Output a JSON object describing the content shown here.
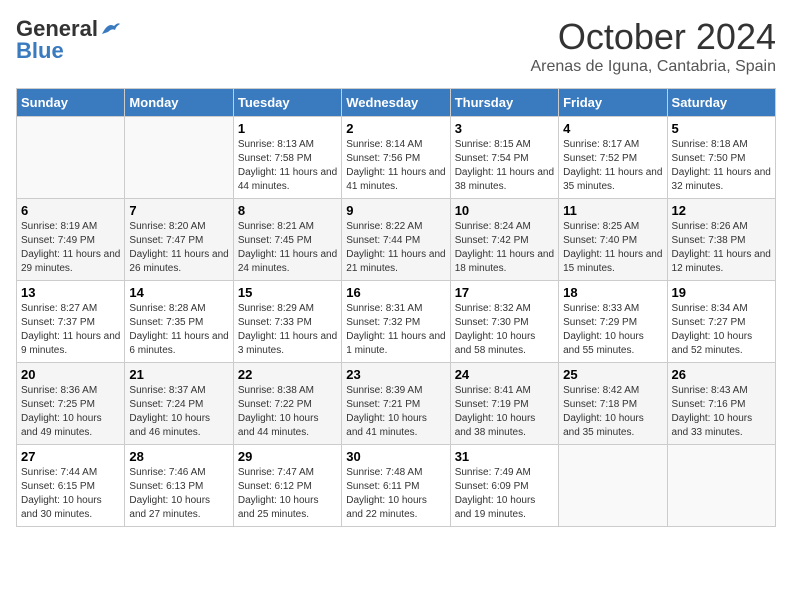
{
  "header": {
    "logo_general": "General",
    "logo_blue": "Blue",
    "month_year": "October 2024",
    "location": "Arenas de Iguna, Cantabria, Spain"
  },
  "weekdays": [
    "Sunday",
    "Monday",
    "Tuesday",
    "Wednesday",
    "Thursday",
    "Friday",
    "Saturday"
  ],
  "weeks": [
    [
      {
        "day": "",
        "info": ""
      },
      {
        "day": "",
        "info": ""
      },
      {
        "day": "1",
        "info": "Sunrise: 8:13 AM\nSunset: 7:58 PM\nDaylight: 11 hours and 44 minutes."
      },
      {
        "day": "2",
        "info": "Sunrise: 8:14 AM\nSunset: 7:56 PM\nDaylight: 11 hours and 41 minutes."
      },
      {
        "day": "3",
        "info": "Sunrise: 8:15 AM\nSunset: 7:54 PM\nDaylight: 11 hours and 38 minutes."
      },
      {
        "day": "4",
        "info": "Sunrise: 8:17 AM\nSunset: 7:52 PM\nDaylight: 11 hours and 35 minutes."
      },
      {
        "day": "5",
        "info": "Sunrise: 8:18 AM\nSunset: 7:50 PM\nDaylight: 11 hours and 32 minutes."
      }
    ],
    [
      {
        "day": "6",
        "info": "Sunrise: 8:19 AM\nSunset: 7:49 PM\nDaylight: 11 hours and 29 minutes."
      },
      {
        "day": "7",
        "info": "Sunrise: 8:20 AM\nSunset: 7:47 PM\nDaylight: 11 hours and 26 minutes."
      },
      {
        "day": "8",
        "info": "Sunrise: 8:21 AM\nSunset: 7:45 PM\nDaylight: 11 hours and 24 minutes."
      },
      {
        "day": "9",
        "info": "Sunrise: 8:22 AM\nSunset: 7:44 PM\nDaylight: 11 hours and 21 minutes."
      },
      {
        "day": "10",
        "info": "Sunrise: 8:24 AM\nSunset: 7:42 PM\nDaylight: 11 hours and 18 minutes."
      },
      {
        "day": "11",
        "info": "Sunrise: 8:25 AM\nSunset: 7:40 PM\nDaylight: 11 hours and 15 minutes."
      },
      {
        "day": "12",
        "info": "Sunrise: 8:26 AM\nSunset: 7:38 PM\nDaylight: 11 hours and 12 minutes."
      }
    ],
    [
      {
        "day": "13",
        "info": "Sunrise: 8:27 AM\nSunset: 7:37 PM\nDaylight: 11 hours and 9 minutes."
      },
      {
        "day": "14",
        "info": "Sunrise: 8:28 AM\nSunset: 7:35 PM\nDaylight: 11 hours and 6 minutes."
      },
      {
        "day": "15",
        "info": "Sunrise: 8:29 AM\nSunset: 7:33 PM\nDaylight: 11 hours and 3 minutes."
      },
      {
        "day": "16",
        "info": "Sunrise: 8:31 AM\nSunset: 7:32 PM\nDaylight: 11 hours and 1 minute."
      },
      {
        "day": "17",
        "info": "Sunrise: 8:32 AM\nSunset: 7:30 PM\nDaylight: 10 hours and 58 minutes."
      },
      {
        "day": "18",
        "info": "Sunrise: 8:33 AM\nSunset: 7:29 PM\nDaylight: 10 hours and 55 minutes."
      },
      {
        "day": "19",
        "info": "Sunrise: 8:34 AM\nSunset: 7:27 PM\nDaylight: 10 hours and 52 minutes."
      }
    ],
    [
      {
        "day": "20",
        "info": "Sunrise: 8:36 AM\nSunset: 7:25 PM\nDaylight: 10 hours and 49 minutes."
      },
      {
        "day": "21",
        "info": "Sunrise: 8:37 AM\nSunset: 7:24 PM\nDaylight: 10 hours and 46 minutes."
      },
      {
        "day": "22",
        "info": "Sunrise: 8:38 AM\nSunset: 7:22 PM\nDaylight: 10 hours and 44 minutes."
      },
      {
        "day": "23",
        "info": "Sunrise: 8:39 AM\nSunset: 7:21 PM\nDaylight: 10 hours and 41 minutes."
      },
      {
        "day": "24",
        "info": "Sunrise: 8:41 AM\nSunset: 7:19 PM\nDaylight: 10 hours and 38 minutes."
      },
      {
        "day": "25",
        "info": "Sunrise: 8:42 AM\nSunset: 7:18 PM\nDaylight: 10 hours and 35 minutes."
      },
      {
        "day": "26",
        "info": "Sunrise: 8:43 AM\nSunset: 7:16 PM\nDaylight: 10 hours and 33 minutes."
      }
    ],
    [
      {
        "day": "27",
        "info": "Sunrise: 7:44 AM\nSunset: 6:15 PM\nDaylight: 10 hours and 30 minutes."
      },
      {
        "day": "28",
        "info": "Sunrise: 7:46 AM\nSunset: 6:13 PM\nDaylight: 10 hours and 27 minutes."
      },
      {
        "day": "29",
        "info": "Sunrise: 7:47 AM\nSunset: 6:12 PM\nDaylight: 10 hours and 25 minutes."
      },
      {
        "day": "30",
        "info": "Sunrise: 7:48 AM\nSunset: 6:11 PM\nDaylight: 10 hours and 22 minutes."
      },
      {
        "day": "31",
        "info": "Sunrise: 7:49 AM\nSunset: 6:09 PM\nDaylight: 10 hours and 19 minutes."
      },
      {
        "day": "",
        "info": ""
      },
      {
        "day": "",
        "info": ""
      }
    ]
  ]
}
